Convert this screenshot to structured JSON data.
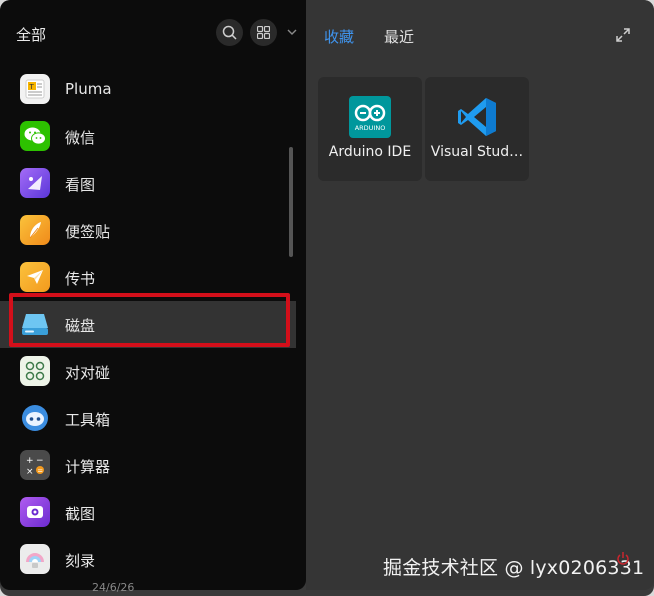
{
  "left_panel": {
    "title": "全部",
    "apps": [
      {
        "label": "Pluma",
        "icon": "pluma-icon",
        "color": "#f2f2f2"
      },
      {
        "label": "微信",
        "icon": "wechat-icon",
        "color": "#2dc100"
      },
      {
        "label": "看图",
        "icon": "image-viewer-icon",
        "color": "#7a4cf0"
      },
      {
        "label": "便签贴",
        "icon": "sticky-notes-icon",
        "color": "#f7a21c"
      },
      {
        "label": "传书",
        "icon": "transfer-icon",
        "color": "#f5a623"
      },
      {
        "label": "磁盘",
        "icon": "disk-icon",
        "color": "#4fb3e8"
      },
      {
        "label": "对对碰",
        "icon": "match-game-icon",
        "color": "#eef4e8"
      },
      {
        "label": "工具箱",
        "icon": "toolbox-icon",
        "color": "#3b8de0"
      },
      {
        "label": "计算器",
        "icon": "calculator-icon",
        "color": "#555555"
      },
      {
        "label": "截图",
        "icon": "screenshot-icon",
        "color": "#8c3fd9"
      },
      {
        "label": "刻录",
        "icon": "burner-icon",
        "color": "#e9e9e9"
      }
    ],
    "bottom_text": "24/6/26"
  },
  "right_panel": {
    "tabs": [
      {
        "label": "收藏",
        "active": true
      },
      {
        "label": "最近",
        "active": false
      }
    ],
    "favorites": [
      {
        "label": "Arduino IDE",
        "icon": "arduino-icon",
        "color": "#00979c"
      },
      {
        "label": "Visual Stud…",
        "icon": "vscode-icon",
        "color": "#1f9cf0"
      }
    ]
  },
  "watermark": "掘金技术社区 @ lyx0206331",
  "colors": {
    "accent": "#3f94ee",
    "highlight_border": "#d30f1a"
  }
}
